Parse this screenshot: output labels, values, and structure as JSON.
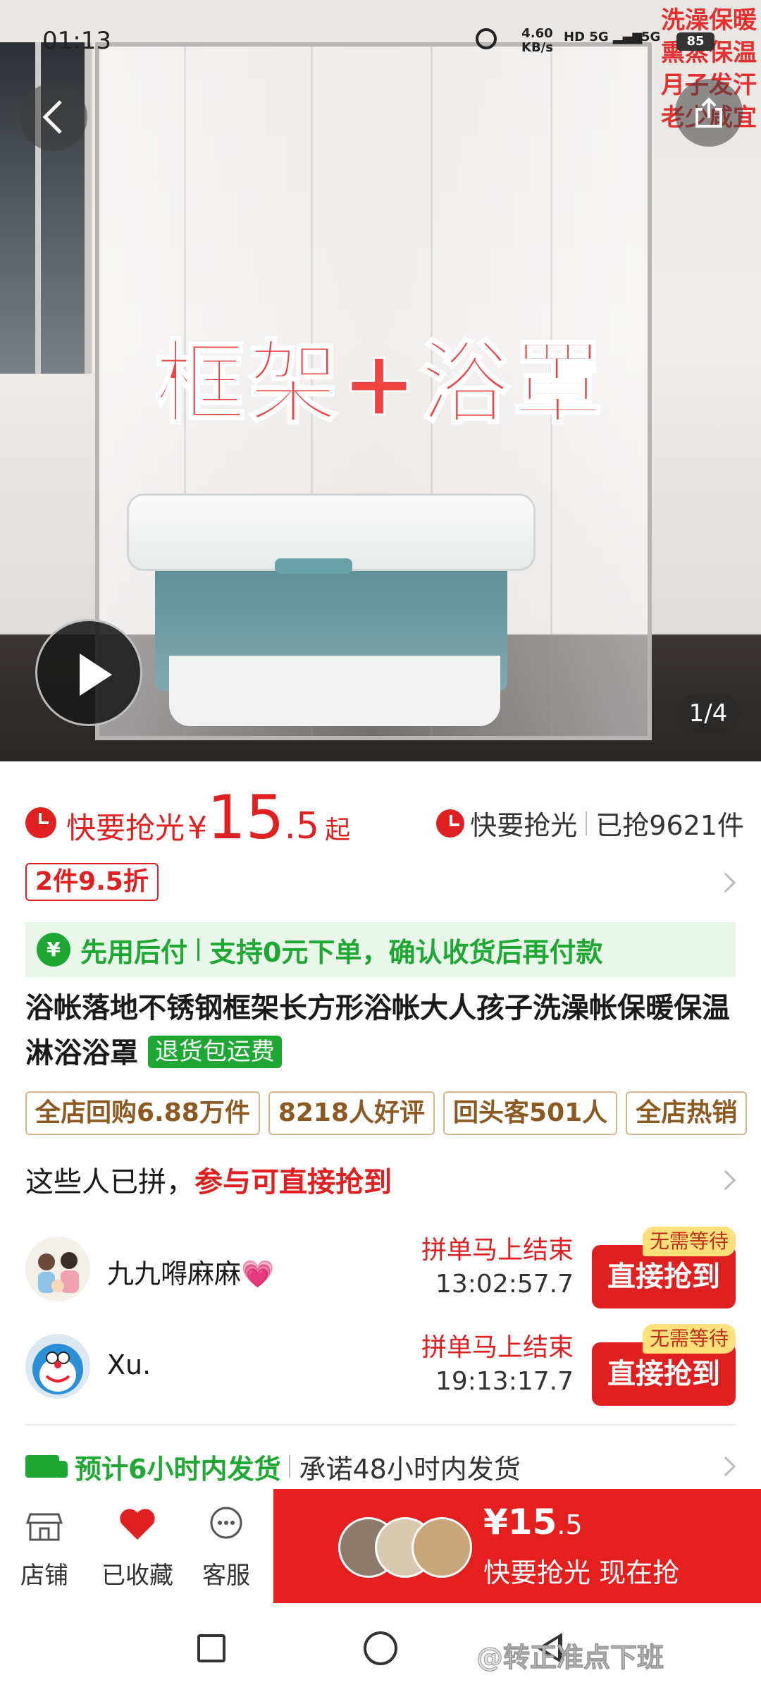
{
  "status_bar": {
    "time": "01:13",
    "net_speed_value": "4.60",
    "net_speed_unit": "KB/s",
    "hd": "HD",
    "sig1": "5G",
    "sig2": "5G",
    "battery": "85"
  },
  "hero": {
    "overlay_title": "框架+浴罩",
    "corner_text": [
      "洗澡保暖",
      "熏蒸保温",
      "月子发汗",
      "老少咸宜"
    ],
    "pager": "1/4",
    "icons": {
      "back": "back-arrow-icon",
      "share": "share-icon",
      "play": "play-icon"
    }
  },
  "price": {
    "alarm_label": "快要抢光",
    "currency": "¥",
    "integer": "15",
    "decimal": ".5",
    "suffix": "起",
    "right_alarm_label": "快要抢光",
    "sold": "已抢9621件",
    "discount_tag": "2件9.5折"
  },
  "pay_later": {
    "badge": "¥",
    "title": "先用后付",
    "detail": "支持0元下单，确认收货后再付款"
  },
  "product": {
    "title": "浴帐落地不锈钢框架长方形浴帐大人孩子洗澡帐保暖保温淋浴浴罩",
    "return_tag": "退货包运费"
  },
  "pills": [
    "全店回购6.88万件",
    "8218人好评",
    "回头客501人",
    "全店热销"
  ],
  "group_buy": {
    "head_prefix": "这些人已拼，",
    "head_highlight": "参与可直接抢到",
    "rows": [
      {
        "name": "九九嘚麻麻💗",
        "ends_label": "拼单马上结束",
        "countdown": "13:02:57.7",
        "button": "直接抢到",
        "badge": "无需等待"
      },
      {
        "name": "Xu.",
        "ends_label": "拼单马上结束",
        "countdown": "19:13:17.7",
        "button": "直接抢到",
        "badge": "无需等待"
      }
    ]
  },
  "shipping": {
    "estimate": "预计6小时内发货",
    "promise": "承诺48小时内发货"
  },
  "bottom_bar": {
    "store": "店铺",
    "favorited": "已收藏",
    "service": "客服",
    "buy_currency": "¥",
    "buy_integer": "15",
    "buy_decimal": ".5",
    "buy_cta": "快要抢光 现在抢"
  },
  "watermark": "@转正准点下班",
  "colors": {
    "accent": "#e02020",
    "green": "#1ea833",
    "buy_bg": "#e51e1e"
  }
}
